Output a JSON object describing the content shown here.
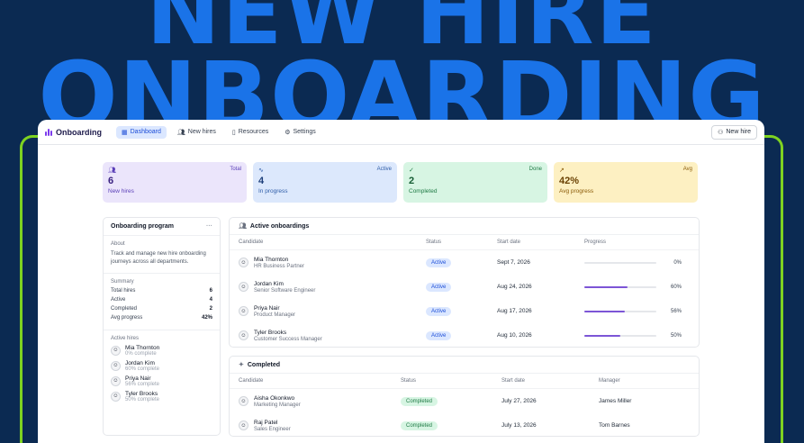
{
  "hero": {
    "line1": "NEW HIRE",
    "line2": "ONBOARDING"
  },
  "topbar": {
    "brand": "Onboarding",
    "nav": [
      {
        "label": "Dashboard",
        "icon": "grid-icon",
        "active": true
      },
      {
        "label": "New hires",
        "icon": "users-icon",
        "active": false
      },
      {
        "label": "Resources",
        "icon": "book-icon",
        "active": false
      },
      {
        "label": "Settings",
        "icon": "gear-icon",
        "active": false
      }
    ],
    "new_hire_button": "New hire"
  },
  "stats": [
    {
      "tag": "Total",
      "value": "6",
      "label": "New hires",
      "icon": "users-icon"
    },
    {
      "tag": "Active",
      "value": "4",
      "label": "In progress",
      "icon": "activity-icon"
    },
    {
      "tag": "Done",
      "value": "2",
      "label": "Completed",
      "icon": "check-circle-icon"
    },
    {
      "tag": "Avg",
      "value": "42%",
      "label": "Avg progress",
      "icon": "trend-up-icon"
    }
  ],
  "sidebar": {
    "title": "Onboarding program",
    "menu_icon": "ellipsis-icon",
    "about_title": "About",
    "about_text": "Track and manage new hire onboarding journeys across all departments.",
    "summary_title": "Summary",
    "summary": [
      {
        "label": "Total hires",
        "value": "6"
      },
      {
        "label": "Active",
        "value": "4"
      },
      {
        "label": "Completed",
        "value": "2"
      },
      {
        "label": "Avg progress",
        "value": "42%"
      }
    ],
    "active_title": "Active hires",
    "active_hires": [
      {
        "name": "Mia Thornton",
        "sub": "0% complete"
      },
      {
        "name": "Jordan Kim",
        "sub": "60% complete"
      },
      {
        "name": "Priya Nair",
        "sub": "56% complete"
      },
      {
        "name": "Tyler Brooks",
        "sub": "50% complete"
      }
    ]
  },
  "active_panel": {
    "title": "Active onboardings",
    "columns": [
      "Candidate",
      "Status",
      "Start date",
      "Progress"
    ],
    "rows": [
      {
        "name": "Mia Thornton",
        "role": "HR Business Partner",
        "status": "Active",
        "start": "Sept 7, 2026",
        "progress": 0,
        "progress_label": "0%"
      },
      {
        "name": "Jordan Kim",
        "role": "Senior Software Engineer",
        "status": "Active",
        "start": "Aug 24, 2026",
        "progress": 60,
        "progress_label": "60%"
      },
      {
        "name": "Priya Nair",
        "role": "Product Manager",
        "status": "Active",
        "start": "Aug 17, 2026",
        "progress": 56,
        "progress_label": "56%"
      },
      {
        "name": "Tyler Brooks",
        "role": "Customer Success Manager",
        "status": "Active",
        "start": "Aug 10, 2026",
        "progress": 50,
        "progress_label": "50%"
      }
    ]
  },
  "completed_panel": {
    "title": "Completed",
    "columns": [
      "Candidate",
      "Status",
      "Start date",
      "Manager"
    ],
    "rows": [
      {
        "name": "Aisha Okonkwo",
        "role": "Marketing Manager",
        "status": "Completed",
        "start": "July 27, 2026",
        "manager": "James Miller"
      },
      {
        "name": "Raj Patel",
        "role": "Sales Engineer",
        "status": "Completed",
        "start": "July 13, 2026",
        "manager": "Tom Barnes"
      }
    ]
  }
}
